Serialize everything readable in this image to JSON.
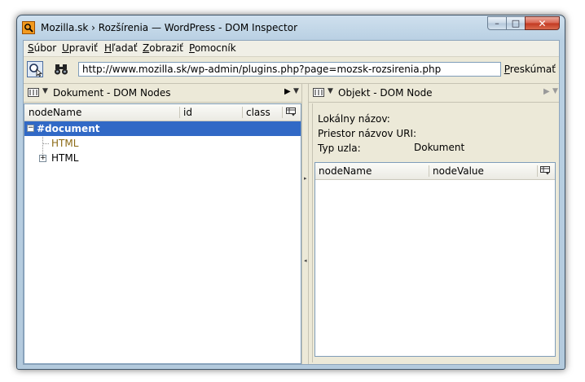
{
  "window": {
    "title": "Mozilla.sk › Rozšírenia — WordPress - DOM Inspector",
    "caption_minimize": "–",
    "caption_maximize": "□",
    "caption_close": "✕"
  },
  "menu": [
    "Súbor",
    "Upraviť",
    "Hľadať",
    "Zobraziť",
    "Pomocník"
  ],
  "toolbar": {
    "url_value": "http://www.mozilla.sk/wp-admin/plugins.php?page=mozsk-rozsirenia.php",
    "inspect_label": "Preskúmať"
  },
  "left_pane": {
    "title": "Dokument - DOM Nodes",
    "columns": [
      "nodeName",
      "id",
      "class"
    ],
    "tree": [
      {
        "label": "#document",
        "level": 0,
        "twisty": "−",
        "selected": true
      },
      {
        "label": "HTML",
        "level": 1,
        "twisty": "",
        "selected": false
      },
      {
        "label": "HTML",
        "level": 1,
        "twisty": "+",
        "selected": false
      }
    ]
  },
  "right_pane": {
    "title": "Objekt - DOM Node",
    "fields": [
      {
        "label": "Lokálny názov:",
        "value": ""
      },
      {
        "label": "Priestor názvov URI:",
        "value": ""
      },
      {
        "label": "Typ uzla:",
        "value": "Dokument"
      }
    ],
    "columns": [
      "nodeName",
      "nodeValue"
    ]
  },
  "colors": {
    "selection": "#3169c6",
    "title_bar": "#b9d0e3",
    "close_button": "#c23820",
    "html_text_node": "#8b6914"
  },
  "icons": {
    "app": "magnifier-document-icon",
    "inspect": "inspect-pointer-icon",
    "search": "binoculars-icon",
    "viewer": "viewer-list-icon",
    "column_picker": "column-picker-icon"
  }
}
